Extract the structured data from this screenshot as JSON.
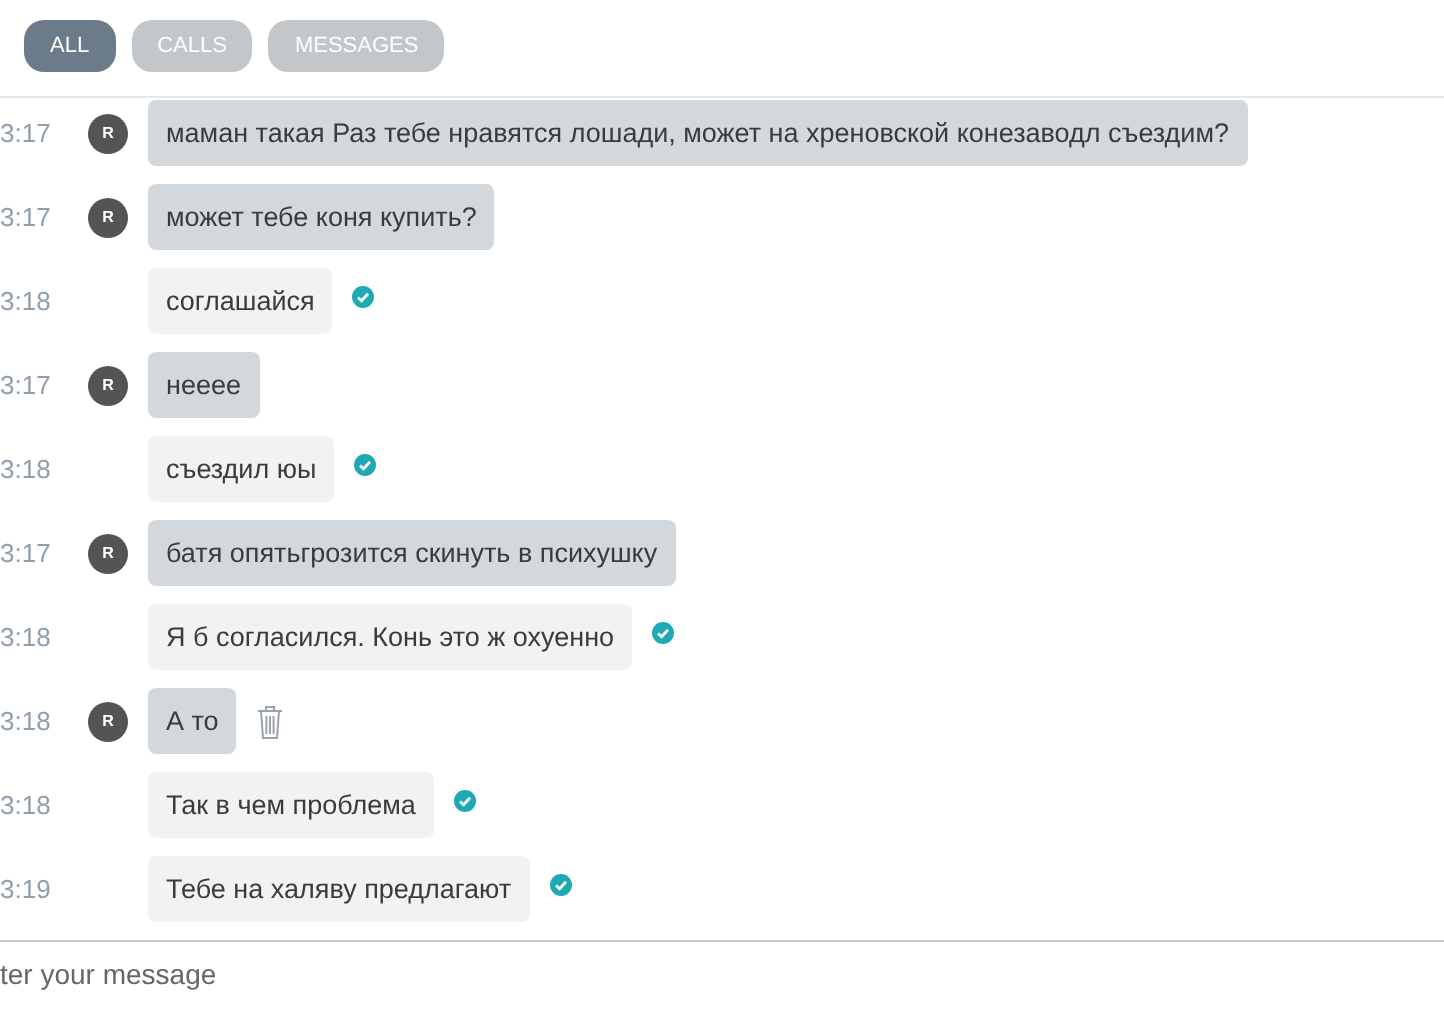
{
  "tabs": [
    {
      "label": "ALL",
      "selected": true
    },
    {
      "label": "CALLS",
      "selected": false
    },
    {
      "label": "MESSAGES",
      "selected": false
    }
  ],
  "messages": [
    {
      "time": "3:17",
      "kind": "incoming",
      "avatar": "R",
      "text": "маман такая Раз тебе нравятся лошади, может на хреновской конезаводл съездим?",
      "hovered": false
    },
    {
      "time": "3:17",
      "kind": "incoming",
      "avatar": "R",
      "text": "может тебе коня купить?",
      "hovered": false
    },
    {
      "time": "3:18",
      "kind": "outgoing",
      "text": "соглашайся",
      "hovered": false
    },
    {
      "time": "3:17",
      "kind": "incoming",
      "avatar": "R",
      "text": "нееее",
      "hovered": false
    },
    {
      "time": "3:18",
      "kind": "outgoing",
      "text": "съездил юы",
      "hovered": false
    },
    {
      "time": "3:17",
      "kind": "incoming",
      "avatar": "R",
      "text": "батя опятьгрозится скинуть в психушку",
      "hovered": false
    },
    {
      "time": "3:18",
      "kind": "outgoing",
      "text": "Я б согласился. Конь это ж охуенно",
      "hovered": false
    },
    {
      "time": "3:18",
      "kind": "incoming",
      "avatar": "R",
      "text": "А то",
      "hovered": true
    },
    {
      "time": "3:18",
      "kind": "outgoing",
      "text": "Так в чем проблема",
      "hovered": false
    },
    {
      "time": "3:19",
      "kind": "outgoing",
      "text": "Тебе на халяву предлагают",
      "hovered": false
    }
  ],
  "composer": {
    "placeholder": "ter your message"
  }
}
